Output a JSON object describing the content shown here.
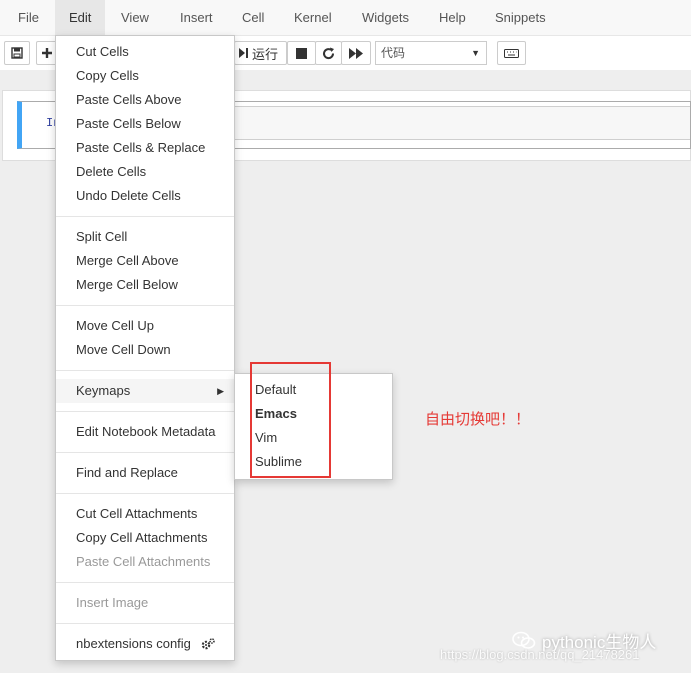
{
  "menubar": {
    "items": [
      {
        "label": "File"
      },
      {
        "label": "Edit"
      },
      {
        "label": "View"
      },
      {
        "label": "Insert"
      },
      {
        "label": "Cell"
      },
      {
        "label": "Kernel"
      },
      {
        "label": "Widgets"
      },
      {
        "label": "Help"
      },
      {
        "label": "Snippets"
      }
    ]
  },
  "toolbar": {
    "run_label": "运行",
    "cell_type": "代码"
  },
  "notebook": {
    "prompt": "In"
  },
  "edit_menu": {
    "items": [
      {
        "label": "Cut Cells"
      },
      {
        "label": "Copy Cells"
      },
      {
        "label": "Paste Cells Above"
      },
      {
        "label": "Paste Cells Below"
      },
      {
        "label": "Paste Cells & Replace"
      },
      {
        "label": "Delete Cells"
      },
      {
        "label": "Undo Delete Cells"
      },
      {
        "label": "Split Cell"
      },
      {
        "label": "Merge Cell Above"
      },
      {
        "label": "Merge Cell Below"
      },
      {
        "label": "Move Cell Up"
      },
      {
        "label": "Move Cell Down"
      },
      {
        "label": "Keymaps"
      },
      {
        "label": "Edit Notebook Metadata"
      },
      {
        "label": "Find and Replace"
      },
      {
        "label": "Cut Cell Attachments"
      },
      {
        "label": "Copy Cell Attachments"
      },
      {
        "label": "Paste Cell Attachments"
      },
      {
        "label": "Insert Image"
      },
      {
        "label": "nbextensions config"
      }
    ]
  },
  "keymaps_submenu": {
    "items": [
      {
        "label": "Default"
      },
      {
        "label": "Emacs"
      },
      {
        "label": "Vim"
      },
      {
        "label": "Sublime"
      }
    ]
  },
  "annotation": "自由切换吧！！",
  "watermark": {
    "brand": "pythonic生物人",
    "url": "https://blog.csdn.net/qq_21478261"
  },
  "colors": {
    "accent_cell": "#42a5f5",
    "highlight": "#e53935"
  }
}
